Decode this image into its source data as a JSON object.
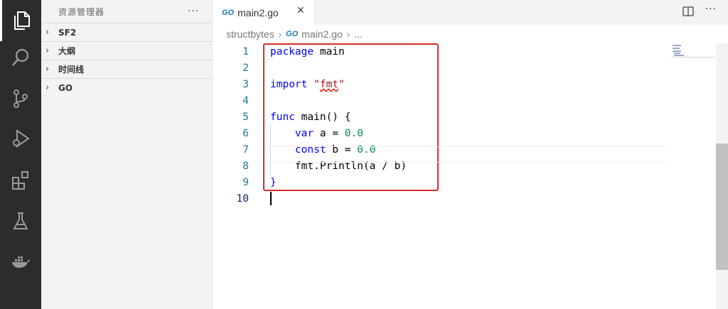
{
  "activity_bar": {
    "icons": [
      "explorer-icon",
      "search-icon",
      "source-control-icon",
      "run-debug-icon",
      "extensions-icon",
      "testing-icon",
      "docker-icon"
    ]
  },
  "sidebar": {
    "title": "资源管理器",
    "more": "···",
    "sections": [
      {
        "label": "SF2"
      },
      {
        "label": "大纲"
      },
      {
        "label": "时间线"
      },
      {
        "label": "GO"
      }
    ]
  },
  "tab": {
    "badge": "GO",
    "label": "main2.go",
    "close": "✕"
  },
  "tabbar_more": "···",
  "breadcrumb": {
    "folder": "structbytes",
    "file_badge": "GO",
    "file": "main2.go",
    "ellipsis": "..."
  },
  "editor": {
    "current_line": 10,
    "lines": [
      {
        "n": "1"
      },
      {
        "n": "2"
      },
      {
        "n": "3"
      },
      {
        "n": "4"
      },
      {
        "n": "5"
      },
      {
        "n": "6"
      },
      {
        "n": "7"
      },
      {
        "n": "8"
      },
      {
        "n": "9"
      },
      {
        "n": "10"
      }
    ],
    "tokens": {
      "l1_kw": "package",
      "l1_rest": " main",
      "l3_kw": "import",
      "l3_q1": "\"",
      "l3_str": "fmt",
      "l3_q2": "\"",
      "l5_kw": "func",
      "l5_rest": " main() {",
      "l6_kw": "var",
      "l6_mid": " a = ",
      "l6_num": "0.0",
      "l7_kw": "const",
      "l7_mid": " b = ",
      "l7_num": "0.0",
      "l8": "fmt.Println(a / b)",
      "l9": "}"
    }
  },
  "colors": {
    "keyword": "#0000ff",
    "string": "#a31515",
    "number": "#098658",
    "line_number": "#237893",
    "highlight_box": "#d92b2b"
  }
}
